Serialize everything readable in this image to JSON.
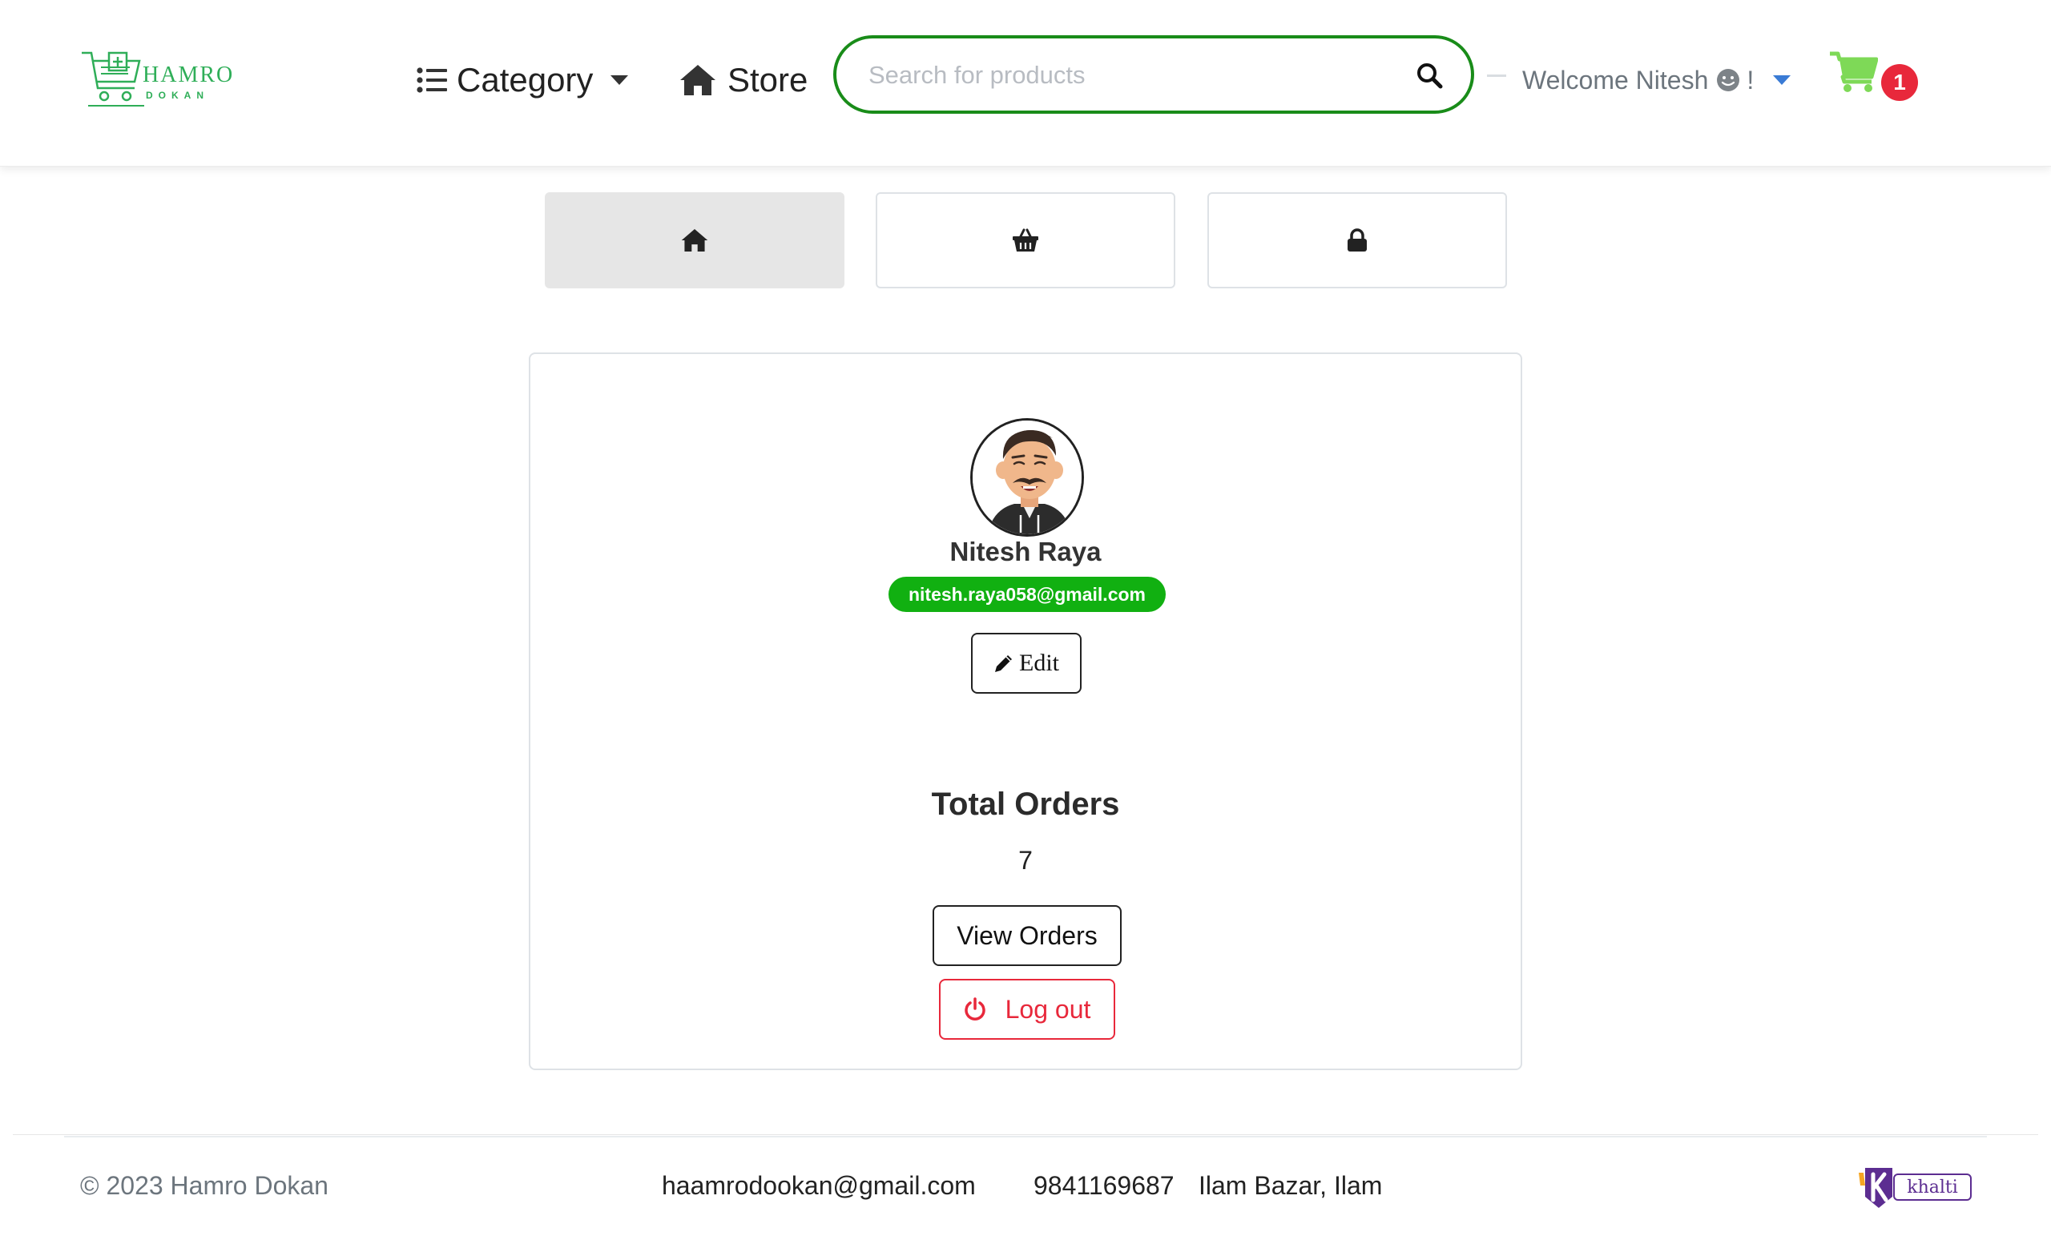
{
  "brand": {
    "name": "HAMRO",
    "subname": "DOKAN",
    "accent": "#2fae58"
  },
  "nav": {
    "category_label": "Category",
    "store_label": "Store",
    "search_placeholder": "Search for products",
    "welcome_label": "Welcome Nitesh",
    "welcome_suffix": "!",
    "cart_count": "1",
    "cart_color": "#7ed957",
    "badge_color": "#e8283b"
  },
  "tabs": [
    {
      "icon": "home-icon",
      "active": true
    },
    {
      "icon": "basket-icon",
      "active": false
    },
    {
      "icon": "lock-icon",
      "active": false
    }
  ],
  "profile": {
    "name": "Nitesh Raya",
    "email": "nitesh.raya058@gmail.com",
    "email_badge_color": "#11b011",
    "edit_label": "Edit"
  },
  "orders": {
    "title": "Total Orders",
    "count": "7",
    "view_label": "View Orders"
  },
  "logout": {
    "label": "Log out",
    "color": "#e8283b"
  },
  "footer": {
    "copyright": "© 2023 Hamro Dokan",
    "email": "haamrodookan@gmail.com",
    "phone": "9841169687",
    "address": "Ilam Bazar, Ilam",
    "payment_logo": "khalti"
  }
}
